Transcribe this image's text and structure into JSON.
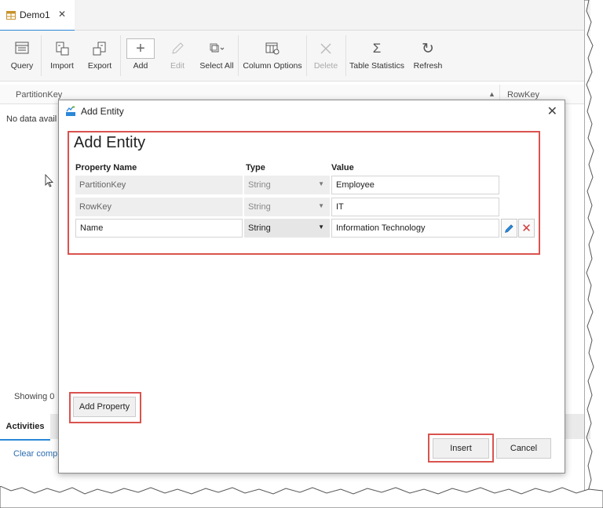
{
  "tab": {
    "title": "Demo1",
    "close_icon": "close-icon",
    "tab_icon": "table-icon"
  },
  "toolbar": {
    "items": [
      {
        "label": "Query",
        "icon": "query-icon",
        "enabled": true
      },
      {
        "label": "Import",
        "icon": "import-icon",
        "enabled": true
      },
      {
        "label": "Export",
        "icon": "export-icon",
        "enabled": true
      },
      {
        "label": "Add",
        "icon": "add-icon",
        "enabled": true
      },
      {
        "label": "Edit",
        "icon": "edit-icon",
        "enabled": false
      },
      {
        "label": "Select All",
        "icon": "select-all-icon",
        "enabled": true
      },
      {
        "label": "Column Options",
        "icon": "column-options-icon",
        "enabled": true
      },
      {
        "label": "Delete",
        "icon": "delete-icon",
        "enabled": false
      },
      {
        "label": "Table Statistics",
        "icon": "sigma-icon",
        "enabled": true
      },
      {
        "label": "Refresh",
        "icon": "refresh-icon",
        "enabled": true
      }
    ]
  },
  "grid": {
    "columns": [
      "PartitionKey",
      "RowKey"
    ],
    "empty_text": "No data avail",
    "showing_text": "Showing 0"
  },
  "bottom": {
    "activities_tab": "Activities",
    "clear_link": "Clear comp"
  },
  "dialog": {
    "title": "Add Entity",
    "heading": "Add Entity",
    "headers": {
      "property": "Property Name",
      "type": "Type",
      "value": "Value"
    },
    "rows": [
      {
        "property": "PartitionKey",
        "type": "String",
        "value": "Employee",
        "editable": false
      },
      {
        "property": "RowKey",
        "type": "String",
        "value": "IT",
        "editable": false
      },
      {
        "property": "Name",
        "type": "String",
        "value": "Information Technology",
        "editable": true
      }
    ],
    "add_property_label": "Add Property",
    "insert_label": "Insert",
    "cancel_label": "Cancel"
  },
  "colors": {
    "accent": "#2b88d8",
    "highlight": "#d9534f",
    "delete_red": "#d23a3a"
  }
}
